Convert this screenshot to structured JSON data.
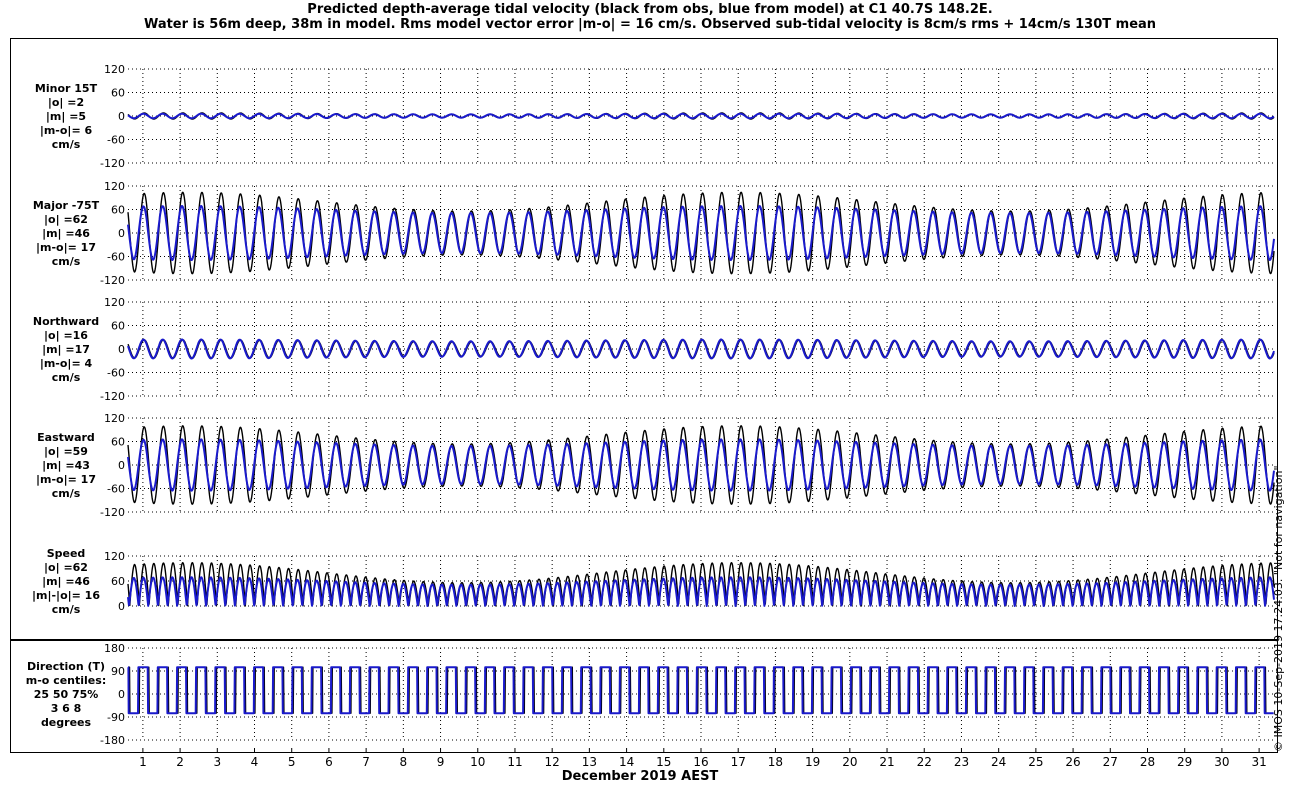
{
  "title_line1": "Predicted depth-average tidal velocity (black from obs, blue from model) at C1 40.7S 148.2E.",
  "title_line2": "Water is 56m deep, 38m in model. Rms model vector error |m-o| = 16 cm/s. Observed sub-tidal velocity is 8cm/s rms + 14cm/s 130T mean",
  "side_note": "© IMOS 10-Sep-2019 17:24:03.  \"Not for navigation\"",
  "colors": {
    "observed": "#000000",
    "model": "#1a1acc"
  },
  "chart_data": [
    {
      "type": "line",
      "panel": "minor",
      "label_lines": [
        "Minor 15T",
        "|o| =2",
        "|m| =5",
        "|m-o|= 6",
        "cm/s"
      ],
      "yticks": [
        120,
        60,
        0,
        -60,
        -120
      ],
      "ylim": [
        -120,
        120
      ],
      "series": [
        {
          "role": "observed",
          "mean_amplitude": 6,
          "modulation": 0.3
        },
        {
          "role": "model",
          "mean_amplitude": 5,
          "modulation": 0.15
        }
      ]
    },
    {
      "type": "line",
      "panel": "major",
      "label_lines": [
        "Major -75T",
        "|o| =62",
        "|m| =46",
        "|m-o|= 17",
        "cm/s"
      ],
      "yticks": [
        120,
        60,
        0,
        -60,
        -120
      ],
      "ylim": [
        -120,
        120
      ],
      "series": [
        {
          "role": "observed",
          "mean_amplitude": 80,
          "modulation": 0.3
        },
        {
          "role": "model",
          "mean_amplitude": 60,
          "modulation": 0.15
        }
      ]
    },
    {
      "type": "line",
      "panel": "northward",
      "label_lines": [
        "Northward",
        "|o| =16",
        "|m| =17",
        "|m-o|= 4",
        "cm/s"
      ],
      "yticks": [
        120,
        60,
        0,
        -60,
        -120
      ],
      "ylim": [
        -120,
        120
      ],
      "series": [
        {
          "role": "observed",
          "mean_amplitude": 21,
          "modulation": 0.12
        },
        {
          "role": "model",
          "mean_amplitude": 22,
          "modulation": 0.1
        }
      ]
    },
    {
      "type": "line",
      "panel": "eastward",
      "label_lines": [
        "Eastward",
        "|o| =59",
        "|m| =43",
        "|m-o|= 17",
        "cm/s"
      ],
      "yticks": [
        120,
        60,
        0,
        -60,
        -120
      ],
      "ylim": [
        -120,
        120
      ],
      "series": [
        {
          "role": "observed",
          "mean_amplitude": 77,
          "modulation": 0.3
        },
        {
          "role": "model",
          "mean_amplitude": 57,
          "modulation": 0.15
        }
      ]
    },
    {
      "type": "line",
      "panel": "speed",
      "label_lines": [
        "Speed",
        "|o| =62",
        "|m| =46",
        "|m|-|o|= 16",
        "cm/s"
      ],
      "yticks": [
        120,
        60,
        0
      ],
      "ylim": [
        0,
        120
      ],
      "series": [
        {
          "role": "observed",
          "mean_amplitude": 80,
          "modulation": 0.3
        },
        {
          "role": "model",
          "mean_amplitude": 60,
          "modulation": 0.15
        }
      ]
    },
    {
      "type": "line",
      "panel": "direction",
      "label_lines": [
        "Direction (T)",
        "m-o centiles:",
        "25  50  75%",
        "3   6   8",
        "degrees"
      ],
      "yticks": [
        180,
        90,
        0,
        -90,
        -180
      ],
      "ylim": [
        -180,
        180
      ],
      "series": [
        {
          "role": "observed",
          "high_level": 105,
          "low_level": -75
        },
        {
          "role": "model",
          "high_level": 105,
          "low_level": -75
        }
      ]
    }
  ],
  "x_axis": {
    "label": "December 2019 AEST",
    "ticks": [
      "1",
      "2",
      "3",
      "4",
      "5",
      "6",
      "7",
      "8",
      "9",
      "10",
      "11",
      "12",
      "13",
      "14",
      "15",
      "16",
      "17",
      "18",
      "19",
      "20",
      "21",
      "22",
      "23",
      "24",
      "25",
      "26",
      "27",
      "28",
      "29",
      "30",
      "31"
    ],
    "day_range": [
      0.6,
      31.4
    ],
    "tidal_period_days": 0.5175,
    "spring_neap_period_days": 14.77,
    "spring_day": 17
  }
}
